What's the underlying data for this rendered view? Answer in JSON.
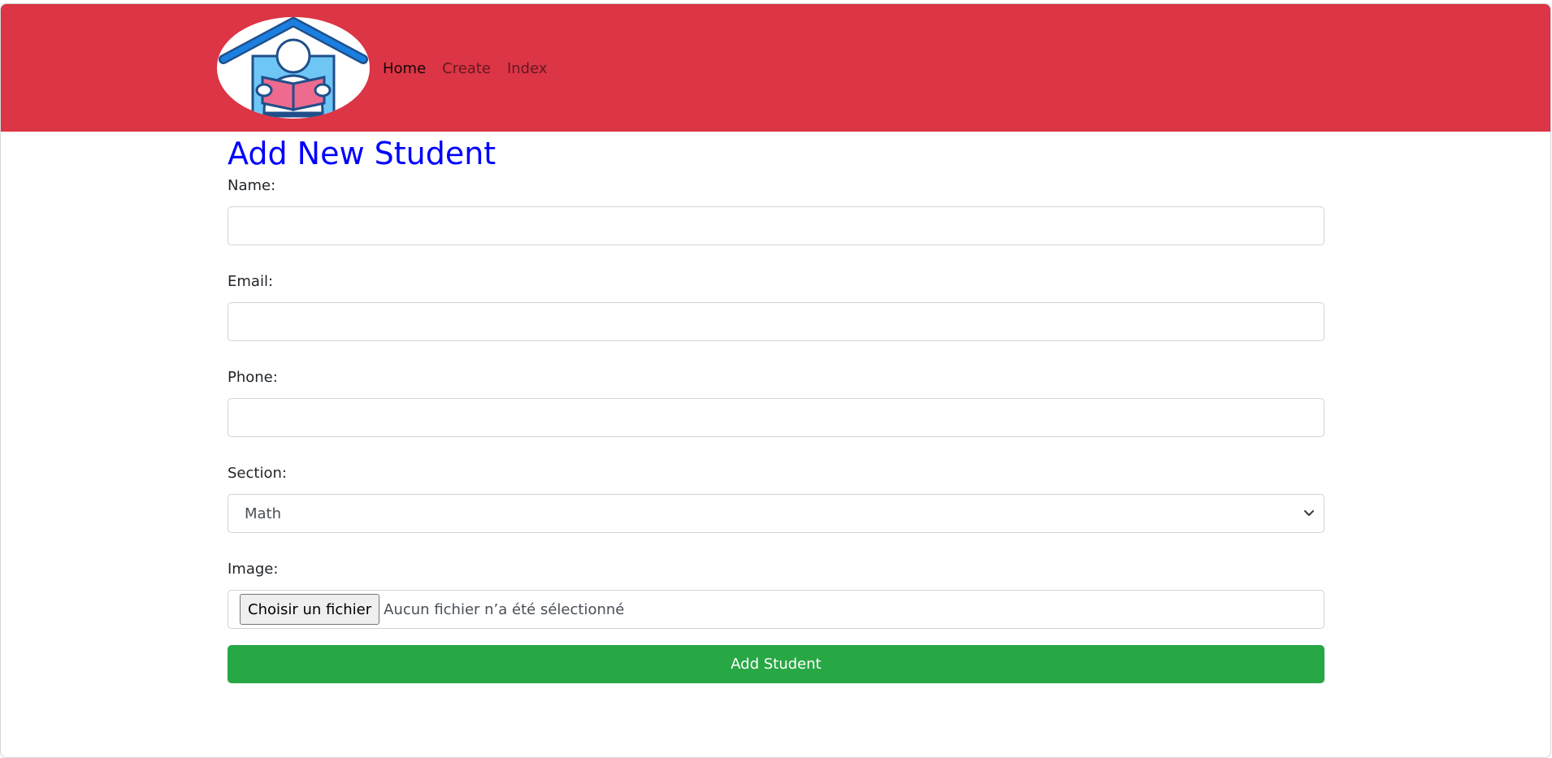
{
  "nav": {
    "links": [
      {
        "label": "Home"
      },
      {
        "label": "Create"
      },
      {
        "label": "Index"
      }
    ],
    "logo_icon": "house-reader-logo"
  },
  "form": {
    "title": "Add New Student",
    "name_label": "Name:",
    "name_value": "",
    "email_label": "Email:",
    "email_value": "",
    "phone_label": "Phone:",
    "phone_value": "",
    "section_label": "Section:",
    "section_value": "Math",
    "image_label": "Image:",
    "file_button_label": "Choisir un fichier",
    "file_status": "Aucun fichier n’a été sélectionné",
    "submit_label": "Add Student"
  },
  "colors": {
    "navbar": "#dc3545",
    "title": "#0000ff",
    "submit": "#28a745"
  }
}
